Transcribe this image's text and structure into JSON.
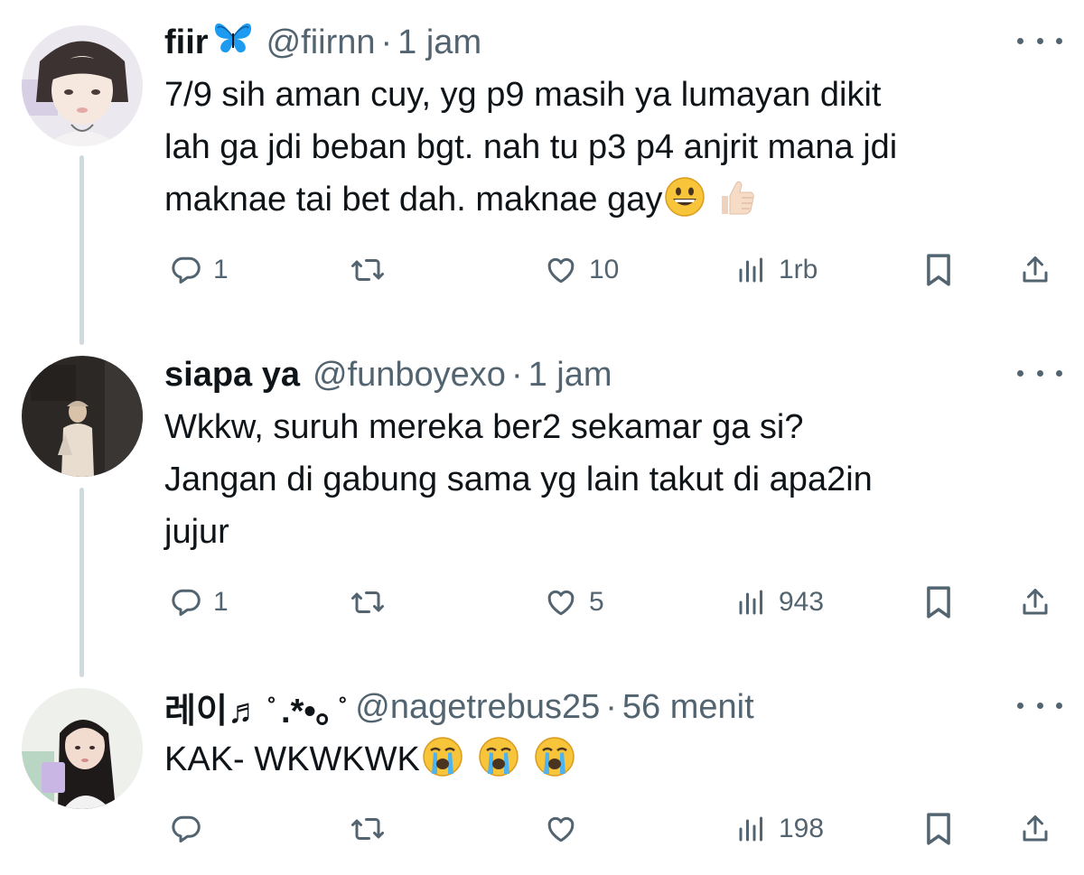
{
  "tweets": [
    {
      "display_name": "fiir",
      "handle": "@fiirnn",
      "separator": "·",
      "time": "1 jam",
      "badge_icon": "butterfly-icon",
      "text": "7/9 sih aman cuy, yg p9 masih ya lumayan dikit\nlah ga jdi beban bgt. nah tu p3 p4 anjrit mana jdi\nmaknae tai bet dah. maknae gay",
      "trailing_emojis": [
        "grinning-face-emoji",
        "thumbs-up-emoji"
      ],
      "replies": "1",
      "reposts": "",
      "likes": "10",
      "views": "1rb"
    },
    {
      "display_name": "siapa ya",
      "handle": "@funboyexo",
      "separator": "·",
      "time": "1 jam",
      "text": "Wkkw, suruh mereka ber2 sekamar ga si?\nJangan di gabung sama yg lain takut di apa2in\njujur",
      "replies": "1",
      "reposts": "",
      "likes": "5",
      "views": "943"
    },
    {
      "display_name": "레이♬ ̊ .*•｡ ̊",
      "handle": "@nagetrebus25",
      "separator": "·",
      "time": "56 menit",
      "text": "KAK- WKWKWK",
      "trailing_emojis": [
        "loudly-crying-face-emoji",
        "loudly-crying-face-emoji",
        "loudly-crying-face-emoji"
      ],
      "replies": "",
      "reposts": "",
      "likes": "",
      "views": "198"
    }
  ],
  "colors": {
    "text": "#0f1419",
    "secondary": "#536471",
    "thread_line": "#cfd9de",
    "badge_blue": "#1d9bf0"
  },
  "icons": [
    "reply-icon",
    "repost-icon",
    "like-icon",
    "views-icon",
    "bookmark-icon",
    "share-icon",
    "more-icon"
  ]
}
